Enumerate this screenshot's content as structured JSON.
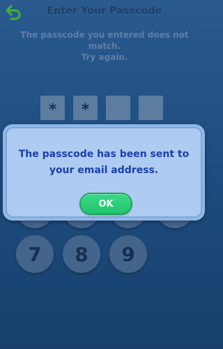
{
  "header": {
    "back_icon": "back-arrow-icon",
    "title": "Enter Your Passcode",
    "subtitle": "The passcode you entered does not match.\nTry again."
  },
  "passcode": {
    "slots": [
      "*",
      "*",
      "",
      ""
    ],
    "filled_count": 2,
    "total_slots": 4
  },
  "keypad": {
    "visible_keys": [
      "7",
      "8",
      "9"
    ]
  },
  "dialog": {
    "message": "The passcode has been sent to your email address.",
    "ok_label": "OK"
  },
  "colors": {
    "background": "#1f4d80",
    "dialog_fill": "#aecbf1",
    "dialog_text": "#1c3fa8",
    "ok_button": "#2ecc7a",
    "slot_fill": "#5c7d9f"
  }
}
